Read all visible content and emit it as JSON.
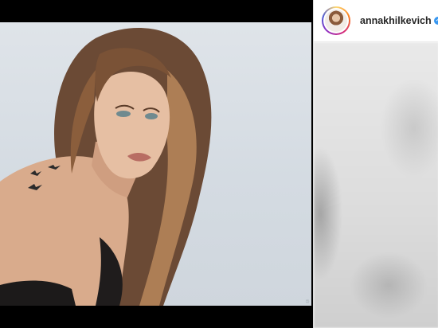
{
  "post": {
    "username": "annakhilkevich",
    "verified_icon": "verified-badge-icon",
    "watermark": "©"
  },
  "colors": {
    "background": "#000000",
    "photo_backdrop": "#dfe4e9",
    "verified_blue": "#3897f0",
    "username_text": "#262626"
  }
}
